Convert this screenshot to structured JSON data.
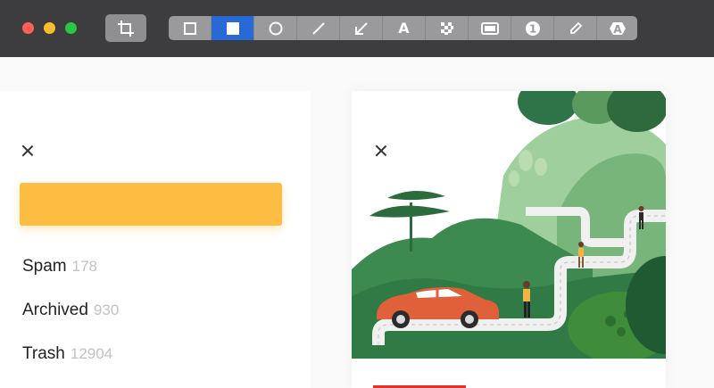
{
  "toolbar": {
    "window_controls": [
      "close",
      "minimize",
      "maximize"
    ],
    "crop_tool": "crop-icon",
    "tools": [
      {
        "name": "rectangle-outline-icon",
        "active": false
      },
      {
        "name": "rectangle-filled-icon",
        "active": true
      },
      {
        "name": "ellipse-icon",
        "active": false
      },
      {
        "name": "line-icon",
        "active": false
      },
      {
        "name": "arrow-icon",
        "active": false
      },
      {
        "name": "text-icon",
        "active": false,
        "glyph": "A"
      },
      {
        "name": "pixelate-icon",
        "active": false
      },
      {
        "name": "highlight-box-icon",
        "active": false
      },
      {
        "name": "step-number-icon",
        "active": false,
        "glyph": "1"
      },
      {
        "name": "pencil-icon",
        "active": false
      },
      {
        "name": "magic-text-icon",
        "active": false,
        "glyph": "A"
      }
    ],
    "active_color": "#2869d6"
  },
  "left_panel": {
    "folders": [
      {
        "label": "Spam",
        "count": "178"
      },
      {
        "label": "Archived",
        "count": "930"
      },
      {
        "label": "Trash",
        "count": "12904"
      }
    ],
    "button_color": "#fcbd42"
  },
  "right_card": {
    "accent_color": "#e3322b",
    "car_color": "#e0603a"
  }
}
